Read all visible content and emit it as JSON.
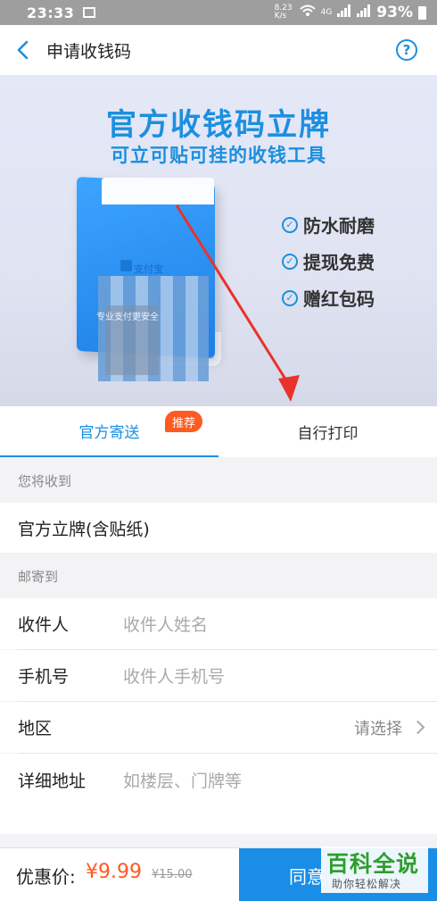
{
  "status_bar": {
    "time": "23:33",
    "net_speed": "8.23 K/s",
    "network": "4G",
    "battery": "93%"
  },
  "nav": {
    "title": "申请收钱码",
    "back_icon": "chevron-left-icon",
    "help_icon": "question-circle-icon"
  },
  "banner": {
    "headline": "官方收钱码立牌",
    "subline": "可立可贴可挂的收钱工具",
    "logo_text": "支付宝",
    "stand_slogan": "专业支付更安全",
    "features": [
      "防水耐磨",
      "提现免费",
      "赠红包码"
    ],
    "accent_color": "#1c8fdf"
  },
  "tabs": [
    {
      "label": "官方寄送",
      "active": true
    },
    {
      "label": "自行打印",
      "active": false
    }
  ],
  "tab_badge": "推荐",
  "receive_section": {
    "label": "您将收到",
    "item": "官方立牌(含贴纸)"
  },
  "mail_section": {
    "label": "邮寄到",
    "recipient": {
      "label": "收件人",
      "placeholder": "收件人姓名"
    },
    "phone": {
      "label": "手机号",
      "placeholder": "收件人手机号"
    },
    "region": {
      "label": "地区",
      "value": "请选择"
    },
    "address": {
      "label": "详细地址",
      "placeholder": "如楼层、门牌等"
    }
  },
  "bottom_bar": {
    "price_label": "优惠价:",
    "price": "¥9.99",
    "original_price": "¥15.00",
    "agree_label": "同意",
    "brand_color": "#1a8ee6",
    "price_color": "#ff5a1f"
  },
  "watermark": {
    "title": "百科全说",
    "subtitle": "助你轻松解决"
  }
}
